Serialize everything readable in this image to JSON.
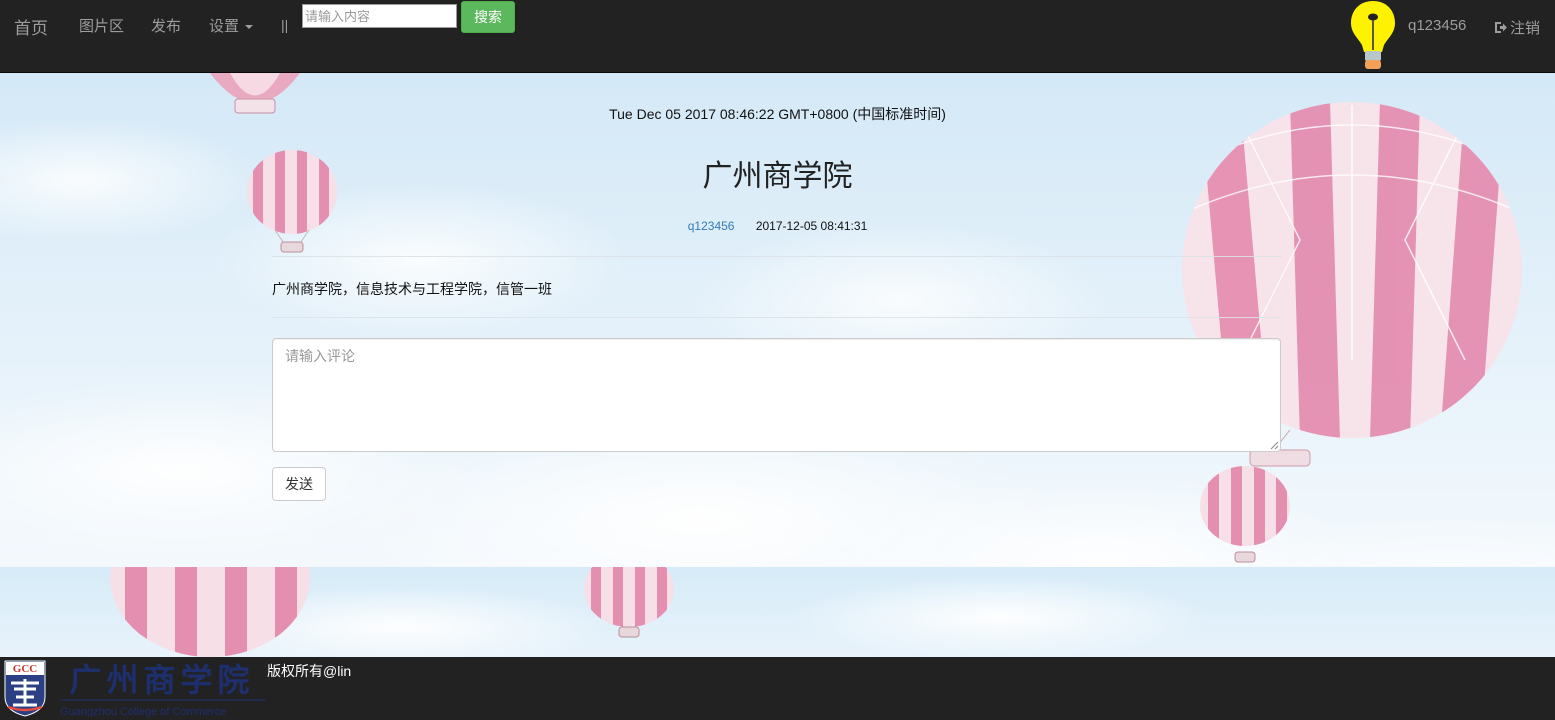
{
  "nav": {
    "brand": "首页",
    "pictures": "图片区",
    "publish": "发布",
    "settings": "设置",
    "separator": "||",
    "search_placeholder": "请输入内容",
    "search_button": "搜索",
    "username": "q123456",
    "logout": "注销"
  },
  "post": {
    "clock": "Tue Dec 05 2017 08:46:22 GMT+0800 (中国标准时间)",
    "title": "广州商学院",
    "author": "q123456",
    "timestamp": "2017-12-05 08:41:31",
    "body": "广州商学院，信息技术与工程学院，信管一班"
  },
  "comment": {
    "placeholder": "请输入评论",
    "send_button": "发送"
  },
  "footer": {
    "logo_badge": "GCC",
    "logo_name": "广州商学院",
    "logo_english": "Guangzhou College of Commerce",
    "copyright": "版权所有@lin"
  },
  "colors": {
    "navbar": "#222222",
    "nav_text": "#9d9d9d",
    "search_button": "#5cb85c",
    "link": "#337ab7",
    "balloon_pink": "#e58fb0"
  }
}
